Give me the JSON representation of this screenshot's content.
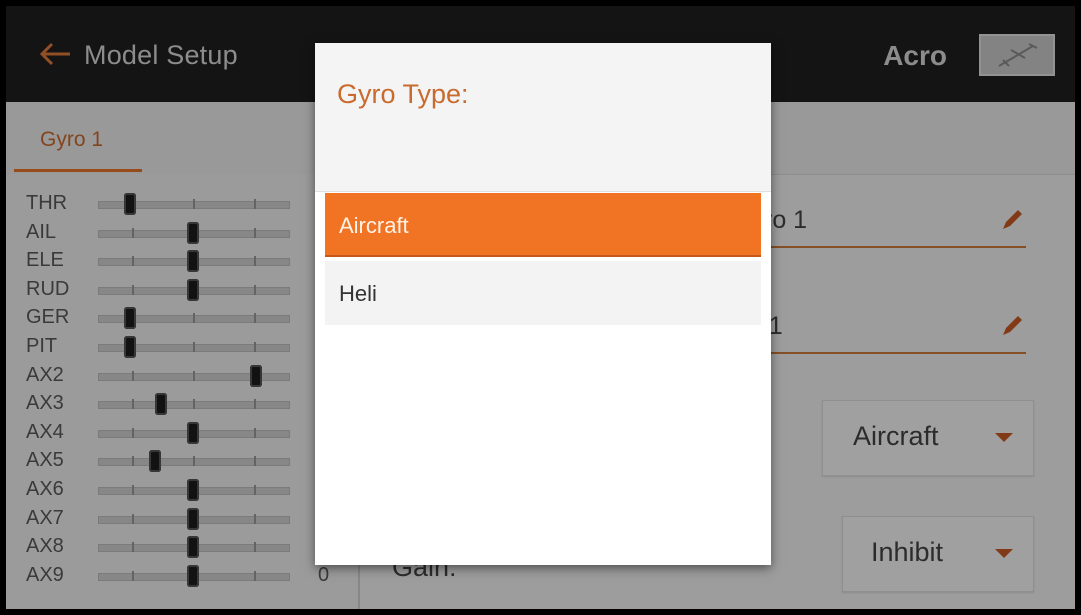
{
  "header": {
    "title": "Model Setup",
    "model_name": "Acro",
    "back_icon": "back-arrow-icon",
    "model_icon": "airplane-icon"
  },
  "tabs": [
    {
      "label": "Gyro 1",
      "active": true
    }
  ],
  "channel_monitor": {
    "channels": [
      {
        "label": "THR",
        "value": "",
        "position": -100
      },
      {
        "label": "AIL",
        "value": "",
        "position": 0
      },
      {
        "label": "ELE",
        "value": "",
        "position": 0
      },
      {
        "label": "RUD",
        "value": "",
        "position": 0
      },
      {
        "label": "GER",
        "value": "",
        "position": -100
      },
      {
        "label": "PIT",
        "value": "",
        "position": -100
      },
      {
        "label": "AX2",
        "value": "",
        "position": 100
      },
      {
        "label": "AX3",
        "value": "",
        "position": -50
      },
      {
        "label": "AX4",
        "value": "",
        "position": 0
      },
      {
        "label": "AX5",
        "value": "",
        "position": -60
      },
      {
        "label": "AX6",
        "value": "",
        "position": 0
      },
      {
        "label": "AX7",
        "value": "",
        "position": 0
      },
      {
        "label": "AX8",
        "value": "",
        "position": 0
      },
      {
        "label": "AX9",
        "value": "0",
        "position": 0
      }
    ]
  },
  "settings": {
    "name_field": {
      "visible_text": "ro 1",
      "icon": "pencil-icon"
    },
    "receiver_field": {
      "visible_text": "'1",
      "icon": "pencil-icon"
    },
    "type_dropdown": {
      "value": "Aircraft",
      "icon": "caret-down-icon"
    },
    "gain_label": "Gain:",
    "gain_dropdown": {
      "value": "Inhibit",
      "icon": "caret-down-icon"
    }
  },
  "dialog": {
    "title": "Gyro Type:",
    "options": [
      {
        "label": "Aircraft",
        "selected": true
      },
      {
        "label": "Heli",
        "selected": false
      }
    ]
  },
  "colors": {
    "accent": "#f07424",
    "accent_text": "#c96a2e",
    "topbar": "#202020"
  }
}
